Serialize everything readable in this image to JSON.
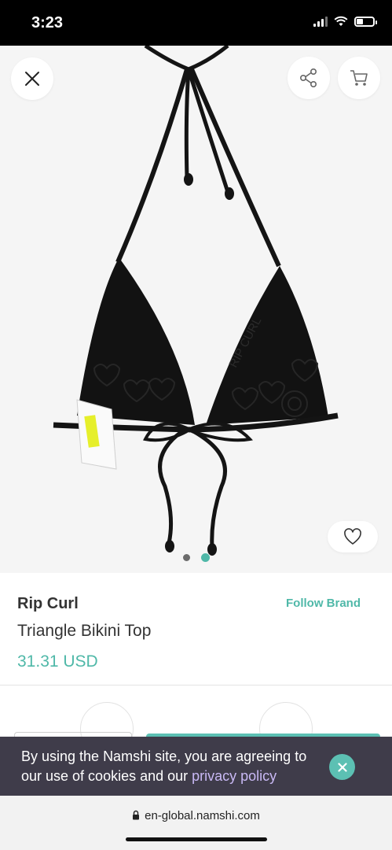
{
  "status_bar": {
    "time": "3:23"
  },
  "product": {
    "brand": "Rip Curl",
    "follow_label": "Follow Brand",
    "title": "Triangle Bikini Top",
    "price": "31.31 USD",
    "image_logo_text": "RIP CURL"
  },
  "gallery": {
    "total": 2,
    "active_index": 2
  },
  "cookie_banner": {
    "text": "By using the Namshi site, you are agreeing to our use of cookies and our ",
    "link": "privacy policy"
  },
  "browser": {
    "url": "en-global.namshi.com"
  },
  "icons": {
    "close": "close-icon",
    "share": "share-icon",
    "cart": "cart-icon",
    "wishlist": "heart-icon",
    "lock": "lock-icon"
  },
  "colors": {
    "accent": "#4fb8a8",
    "banner_bg": "#3f3c4a",
    "link": "#c9b9f5"
  }
}
